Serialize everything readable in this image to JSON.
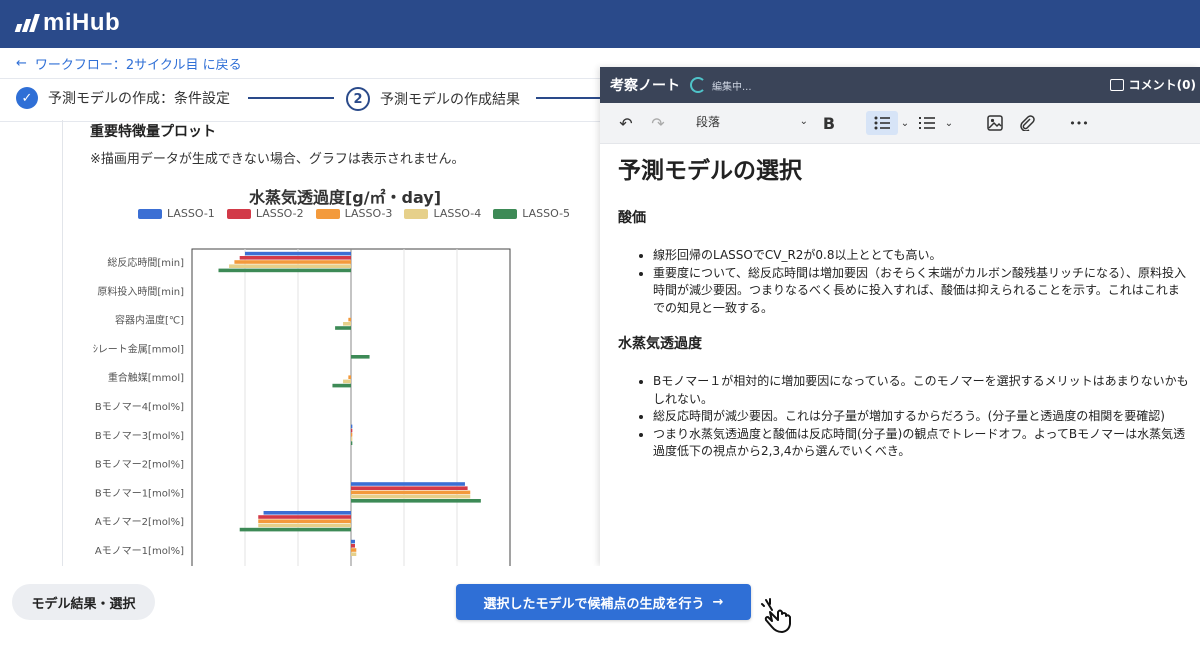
{
  "app": {
    "name": "miHub"
  },
  "nav": {
    "back_arrow": "←",
    "back_label": "ワークフロー：2サイクル目 に戻る"
  },
  "stepper": {
    "steps": [
      {
        "label": "予測モデルの作成：条件設定",
        "state": "done",
        "marker": "✓"
      },
      {
        "label": "予測モデルの作成結果",
        "state": "current",
        "marker": "2"
      }
    ]
  },
  "importance": {
    "heading": "重要特徴量プロット",
    "note": "※描画用データが生成できない場合、グラフは表示されません。"
  },
  "chart_data": {
    "type": "bar",
    "orientation": "horizontal",
    "title": "水蒸気透過度[g/㎡・day]",
    "legend_position": "top",
    "grid": true,
    "categories": [
      "総反応時間[min]",
      "原料投入時間[min]",
      "容器内温度[℃]",
      "ｼレート金属[mmol]",
      "重合触媒[mmol]",
      "Bモノマー4[mol%]",
      "Bモノマー3[mol%]",
      "Bモノマー2[mol%]",
      "Bモノマー1[mol%]",
      "Aモノマー2[mol%]",
      "Aモノマー1[mol%]"
    ],
    "series": [
      {
        "name": "LASSO-1",
        "color": "#3b6fd4",
        "values": [
          -0.4,
          0,
          0,
          0,
          0,
          0,
          0.005,
          0,
          0.43,
          -0.33,
          0.015
        ]
      },
      {
        "name": "LASSO-2",
        "color": "#d23a48",
        "values": [
          -0.42,
          0,
          0,
          0,
          0,
          0,
          0.005,
          0,
          0.44,
          -0.35,
          0.015
        ]
      },
      {
        "name": "LASSO-3",
        "color": "#f39a3c",
        "values": [
          -0.44,
          0,
          -0.01,
          0,
          -0.01,
          0,
          0.005,
          0,
          0.45,
          -0.35,
          0.02
        ]
      },
      {
        "name": "LASSO-4",
        "color": "#e6d08a",
        "values": [
          -0.46,
          0,
          -0.03,
          0,
          -0.03,
          0,
          0.005,
          0,
          0.45,
          -0.35,
          0.02
        ]
      },
      {
        "name": "LASSO-5",
        "color": "#3d8a56",
        "values": [
          -0.5,
          0,
          -0.06,
          0.07,
          -0.07,
          0,
          0.005,
          0,
          0.49,
          -0.42,
          0
        ]
      }
    ],
    "xlim": [
      -0.6,
      0.6
    ]
  },
  "note": {
    "title": "考察ノート",
    "status": "編集中...",
    "comment_label": "コメント(0)",
    "toolbar": {
      "undo": "↶",
      "redo": "↷",
      "paragraph": "段落",
      "bold": "B",
      "more": "•••"
    },
    "heading": "予測モデルの選択",
    "sections": [
      {
        "title": "酸価",
        "items": [
          "線形回帰のLASSOでCV_R2が0.8以上ととても高い。",
          "重要度について、総反応時間は増加要因（おそらく末端がカルボン酸残基リッチになる）、原料投入時間が減少要因。つまりなるべく長めに投入すれば、酸価は抑えられることを示す。これはこれまでの知見と一致する。"
        ]
      },
      {
        "title": "水蒸気透過度",
        "items": [
          "Bモノマー１が相対的に増加要因になっている。このモノマーを選択するメリットはあまりないかもしれない。",
          "総反応時間が減少要因。これは分子量が増加するからだろう。(分子量と透過度の相関を要確認)",
          "つまり水蒸気透過度と酸価は反応時間(分子量)の観点でトレードオフ。よってBモノマーは水蒸気透過度低下の視点から2,3,4から選んでいくべき。"
        ]
      }
    ]
  },
  "footer": {
    "model_button": "モデル結果・選択",
    "generate_button": "選択したモデルで候補点の生成を行う",
    "generate_arrow": "→"
  },
  "colors": {
    "header": "#2a4a8a",
    "accent": "#2f6fd6",
    "note_header": "#3a4458"
  }
}
